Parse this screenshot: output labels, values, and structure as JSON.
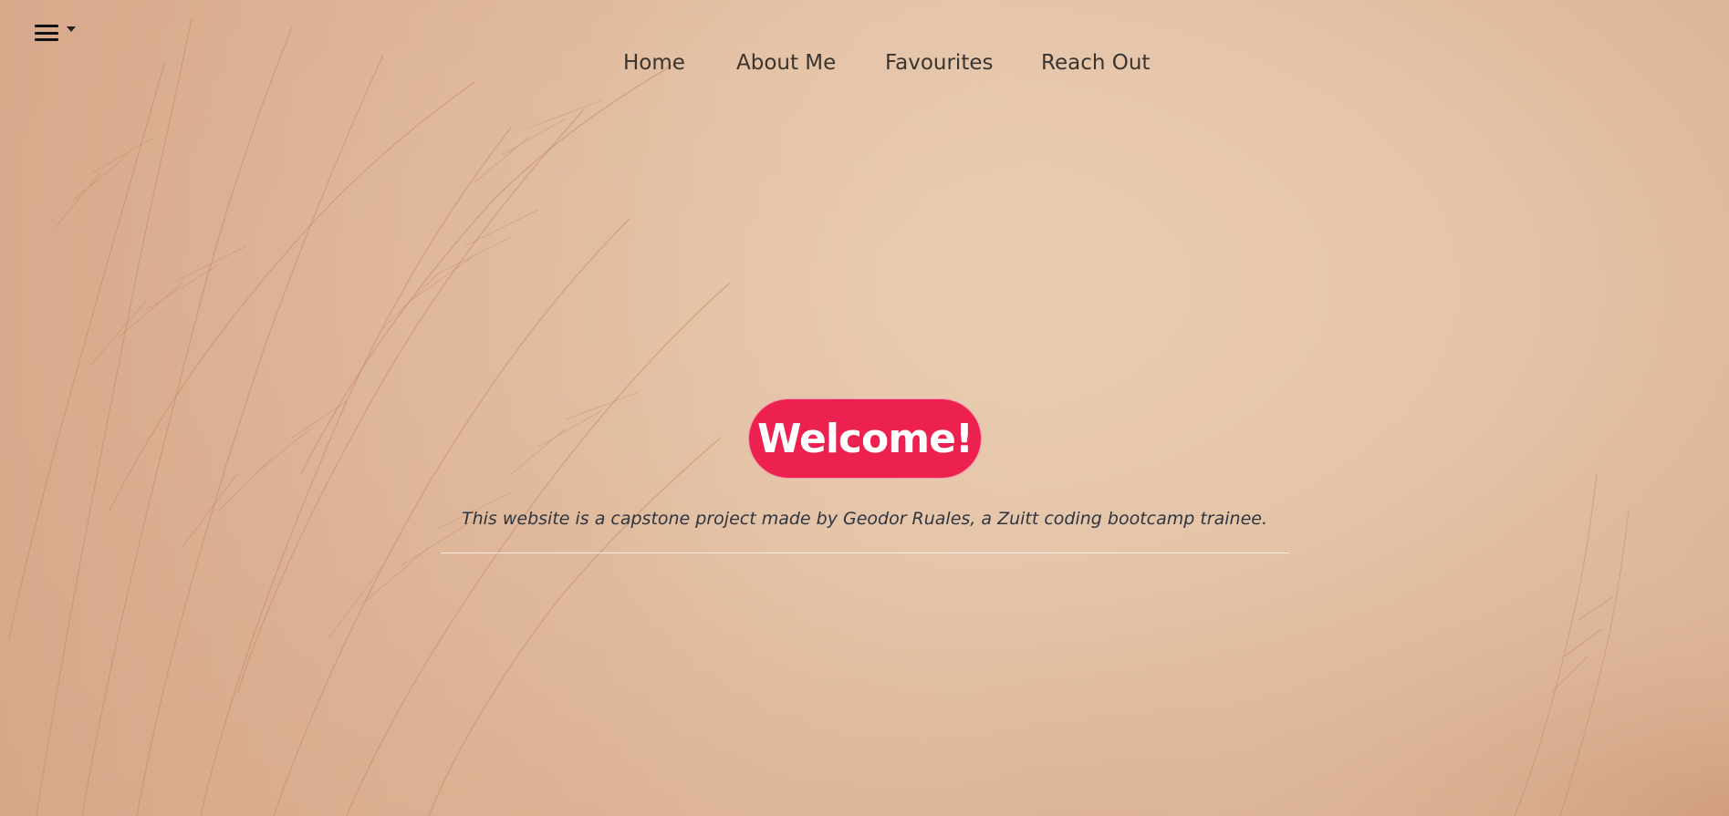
{
  "nav": {
    "menu_toggle_icon": "hamburger-menu-icon",
    "caret_icon": "caret-down-icon",
    "links": [
      "Home",
      "About Me",
      "Favourites",
      "Reach Out"
    ]
  },
  "hero": {
    "welcome": "Welcome!",
    "tagline": "This website is a capstone project made by Geodor Ruales, a Zuitt coding bootcamp trainee."
  },
  "colors": {
    "accent": "#ec2150",
    "background": "#e6c6aa",
    "nav_text": "#3a3431",
    "tagline_text": "#2e3540",
    "divider": "#f5ebe2"
  }
}
